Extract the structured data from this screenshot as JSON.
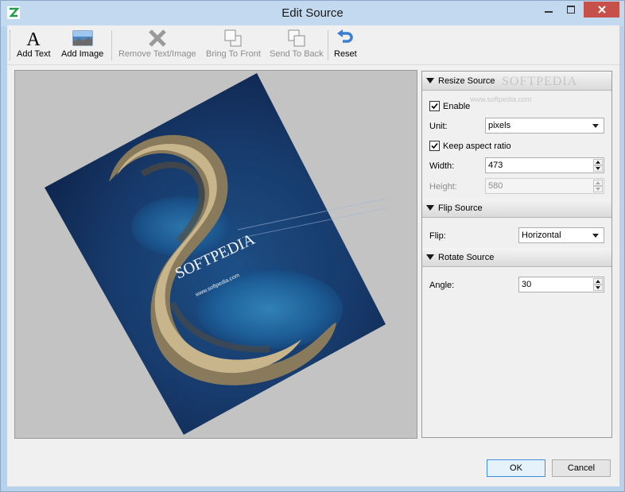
{
  "window": {
    "title": "Edit Source",
    "close_color": "#c7504b"
  },
  "toolbar": {
    "add_text": "Add Text",
    "add_image": "Add Image",
    "remove": "Remove Text/Image",
    "bring_front": "Bring To Front",
    "send_back": "Send To Back",
    "reset": "Reset"
  },
  "image": {
    "watermark_main": "SOFTPEDIA",
    "watermark_sub": "www.softpedia.com",
    "overlay_main": "SOFTPEDIA",
    "overlay_sub": "www.softpedia.com"
  },
  "resize": {
    "header": "Resize Source",
    "enable_label": "Enable",
    "enable_checked": true,
    "unit_label": "Unit:",
    "unit_value": "pixels",
    "keep_label": "Keep aspect ratio",
    "keep_checked": true,
    "width_label": "Width:",
    "width_value": "473",
    "height_label": "Height:",
    "height_value": "580"
  },
  "flip": {
    "header": "Flip Source",
    "label": "Flip:",
    "value": "Horizontal"
  },
  "rotate": {
    "header": "Rotate Source",
    "label": "Angle:",
    "value": "30"
  },
  "footer": {
    "ok": "OK",
    "cancel": "Cancel"
  }
}
